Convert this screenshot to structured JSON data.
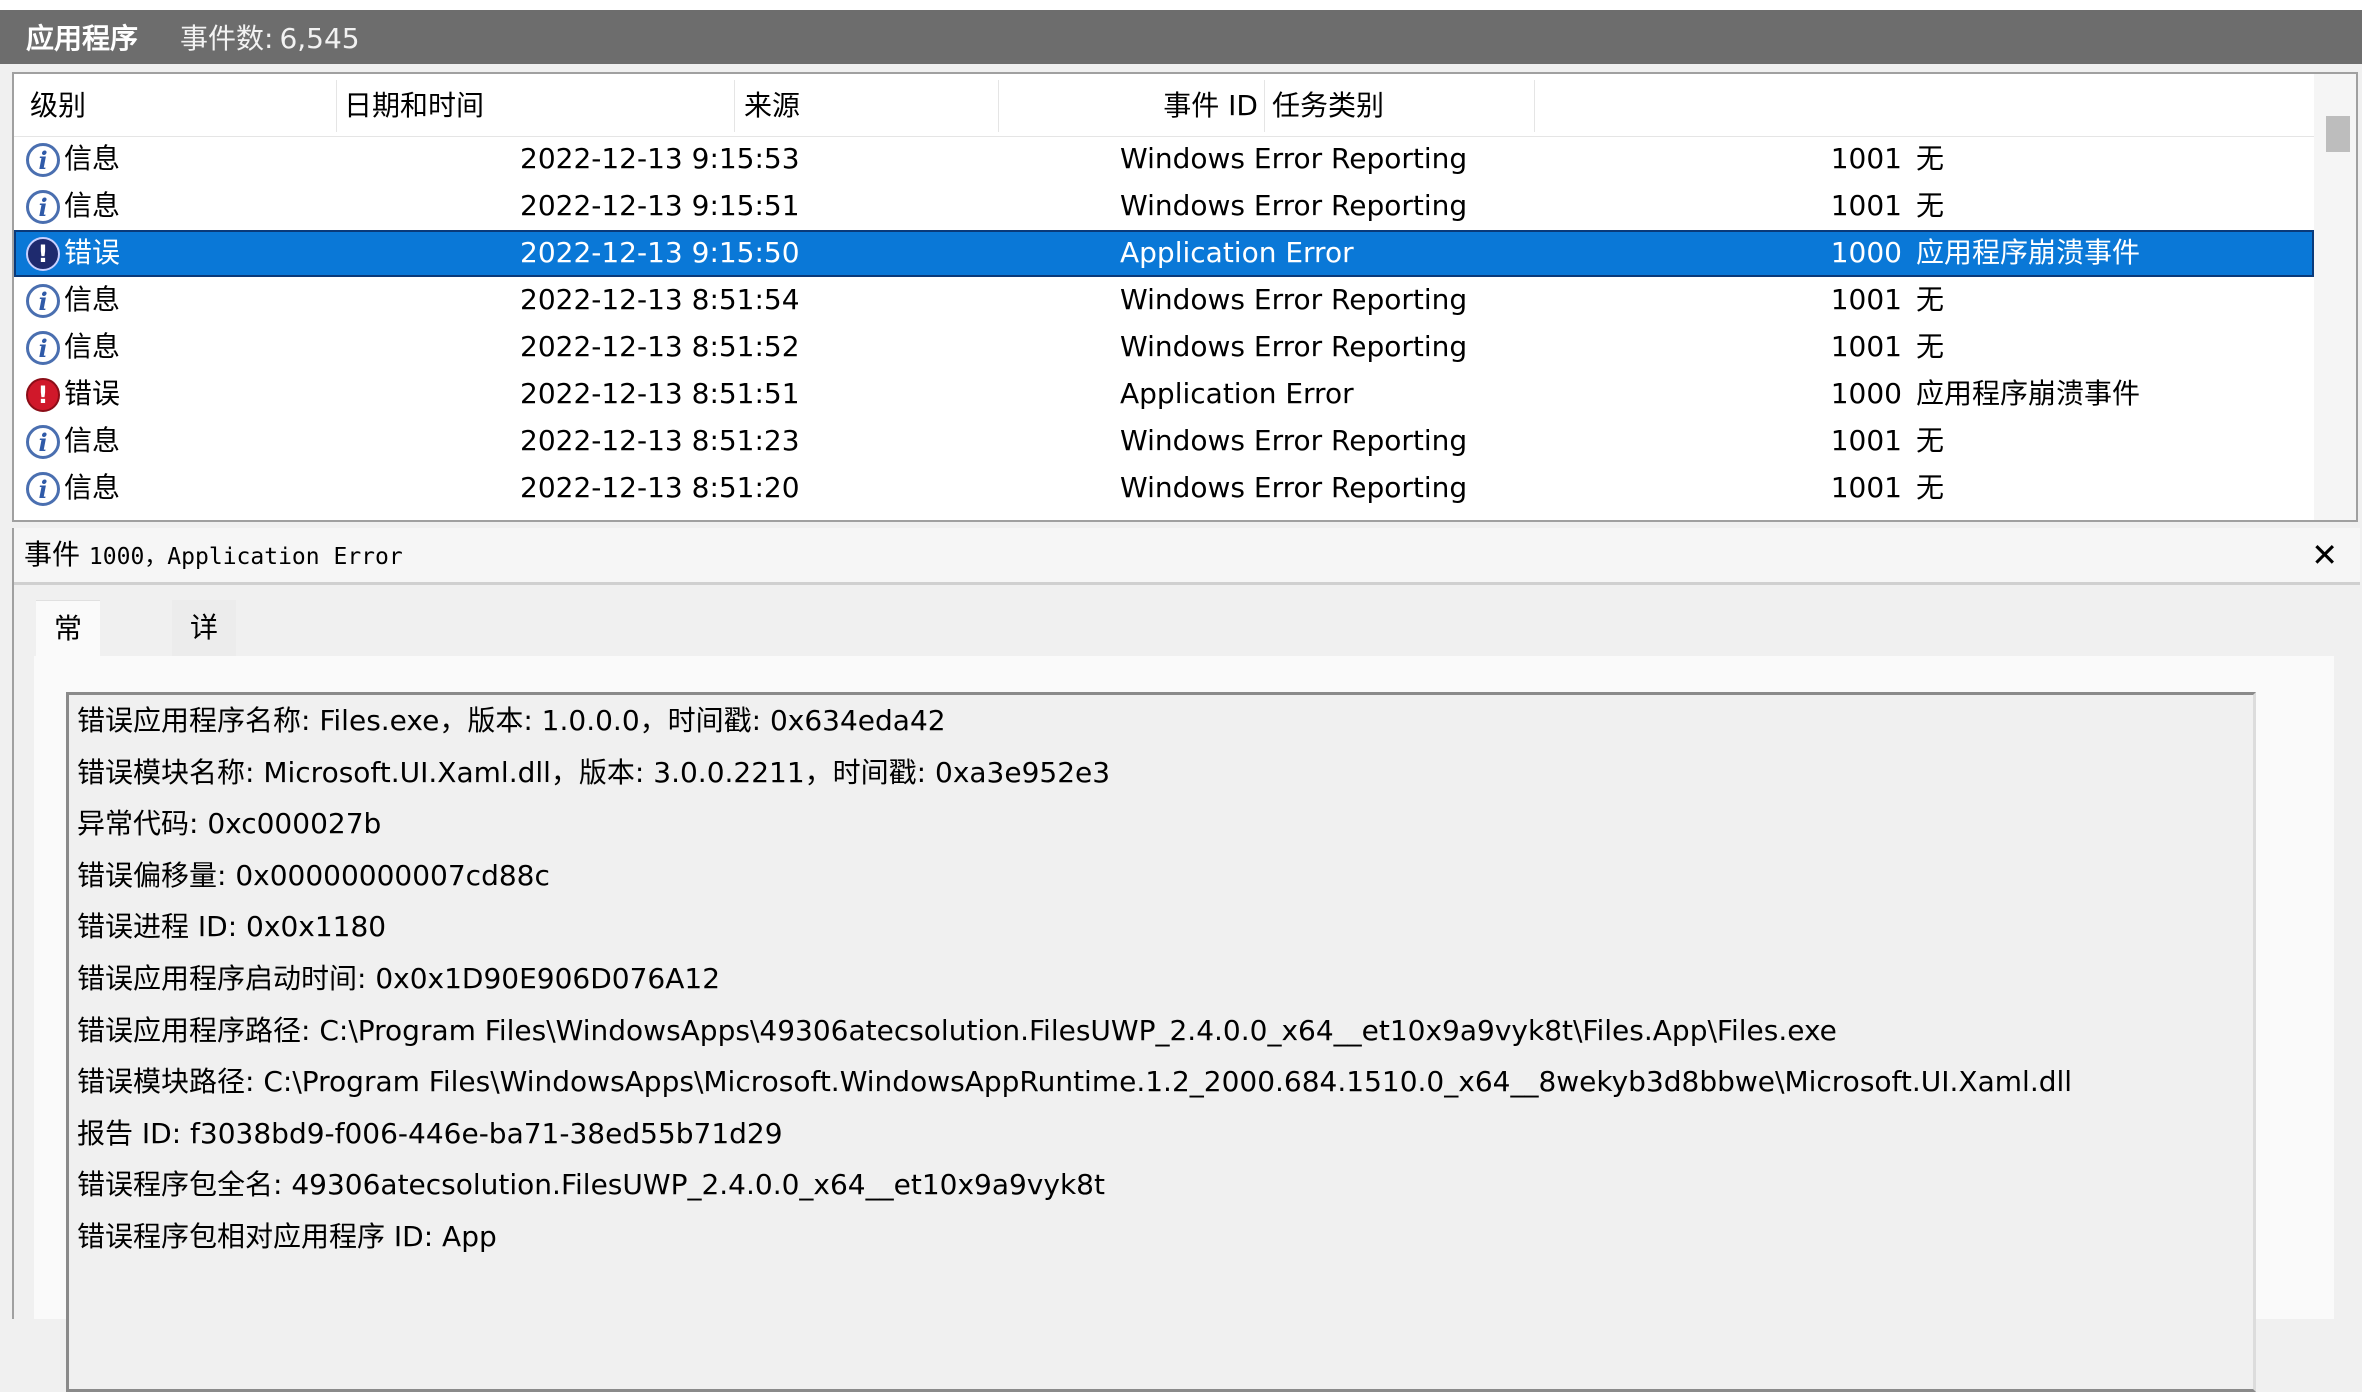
{
  "header": {
    "title": "应用程序",
    "count_label": "事件数:",
    "count_value": "6,545"
  },
  "list": {
    "columns": [
      "级别",
      "日期和时间",
      "来源",
      "事件 ID",
      "任务类别"
    ],
    "rows": [
      {
        "level": "信息",
        "icon": "info-icon",
        "datetime": "2022-12-13 9:15:53",
        "source": "Windows Error Reporting",
        "event_id": "1001",
        "task": "无"
      },
      {
        "level": "信息",
        "icon": "info-icon",
        "datetime": "2022-12-13 9:15:51",
        "source": "Windows Error Reporting",
        "event_id": "1001",
        "task": "无"
      },
      {
        "level": "错误",
        "icon": "error-icon",
        "datetime": "2022-12-13 9:15:50",
        "source": "Application Error",
        "event_id": "1000",
        "task": "应用程序崩溃事件",
        "selected": true
      },
      {
        "level": "信息",
        "icon": "info-icon",
        "datetime": "2022-12-13 8:51:54",
        "source": "Windows Error Reporting",
        "event_id": "1001",
        "task": "无"
      },
      {
        "level": "信息",
        "icon": "info-icon",
        "datetime": "2022-12-13 8:51:52",
        "source": "Windows Error Reporting",
        "event_id": "1001",
        "task": "无"
      },
      {
        "level": "错误",
        "icon": "error-icon",
        "datetime": "2022-12-13 8:51:51",
        "source": "Application Error",
        "event_id": "1000",
        "task": "应用程序崩溃事件"
      },
      {
        "level": "信息",
        "icon": "info-icon",
        "datetime": "2022-12-13 8:51:23",
        "source": "Windows Error Reporting",
        "event_id": "1001",
        "task": "无"
      },
      {
        "level": "信息",
        "icon": "info-icon",
        "datetime": "2022-12-13 8:51:20",
        "source": "Windows Error Reporting",
        "event_id": "1001",
        "task": "无"
      }
    ]
  },
  "detail": {
    "title_prefix": "事件",
    "title_rest": "1000，Application Error",
    "close_glyph": "✕",
    "tabs": [
      "常规",
      "详细信息"
    ],
    "lines": [
      "错误应用程序名称: Files.exe，版本: 1.0.0.0，时间戳: 0x634eda42",
      "错误模块名称: Microsoft.UI.Xaml.dll，版本: 3.0.0.2211，时间戳: 0xa3e952e3",
      "异常代码: 0xc000027b",
      "错误偏移量: 0x00000000007cd88c",
      "错误进程 ID: 0x0x1180",
      "错误应用程序启动时间: 0x0x1D90E906D076A12",
      "错误应用程序路径: C:\\Program Files\\WindowsApps\\49306atecsolution.FilesUWP_2.4.0.0_x64__et10x9a9vyk8t\\Files.App\\Files.exe",
      "错误模块路径: C:\\Program Files\\WindowsApps\\Microsoft.WindowsAppRuntime.1.2_2000.684.1510.0_x64__8wekyb3d8bbwe\\Microsoft.UI.Xaml.dll",
      "报告 ID: f3038bd9-f006-446e-ba71-38ed55b71d29",
      "错误程序包全名: 49306atecsolution.FilesUWP_2.4.0.0_x64__et10x9a9vyk8t",
      "错误程序包相对应用程序 ID: App"
    ]
  },
  "colors": {
    "selection": "#0a78d7",
    "titlebar": "#6d6d6d",
    "error_icon": "#d0182a",
    "info_icon": "#4a6fb0"
  }
}
